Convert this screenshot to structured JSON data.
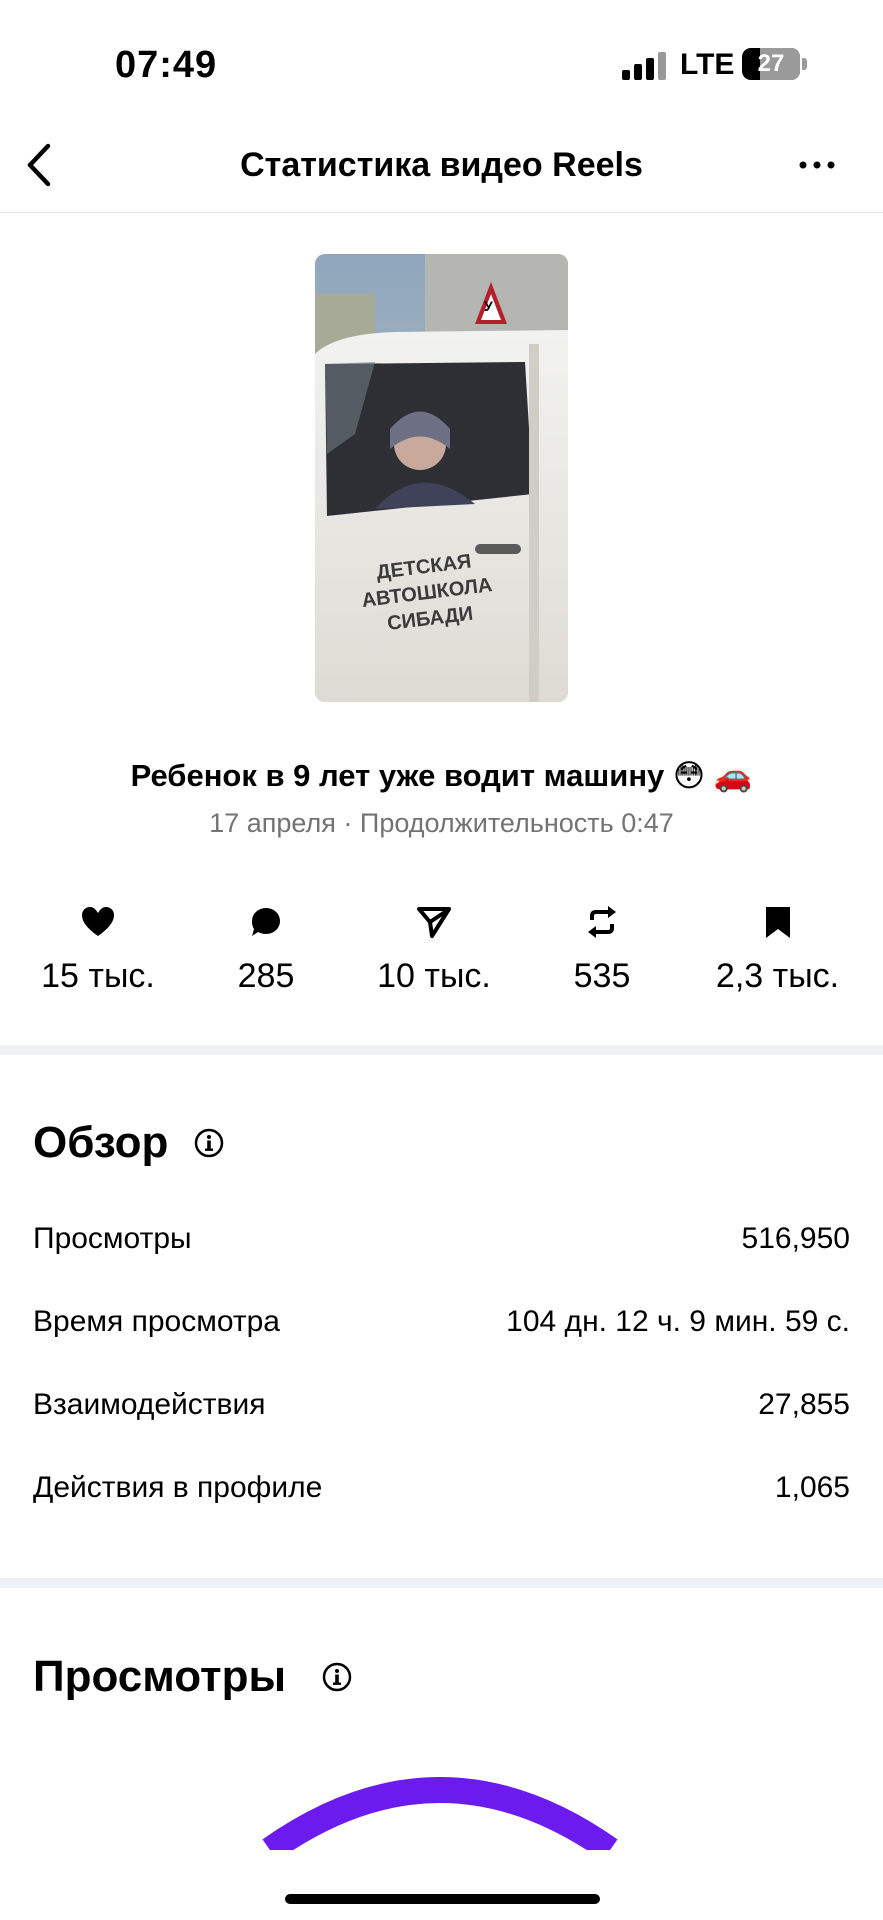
{
  "status_bar": {
    "time": "07:49",
    "network": "LTE",
    "battery": "27"
  },
  "header": {
    "title": "Статистика видео Reels",
    "back_icon": "chevron-left-icon",
    "more_icon": "more-horizontal-icon"
  },
  "thumbnail": {
    "caption_lines": [
      "ДЕТСКАЯ",
      "АВТОШКОЛА",
      "СИБАДИ"
    ],
    "sign_text": "У"
  },
  "reel": {
    "title": "Ребенок в 9 лет уже водит машину 😳 🚗",
    "meta": "17 апреля · Продолжительность 0:47"
  },
  "metrics": [
    {
      "icon": "heart-icon",
      "value": "15 тыс."
    },
    {
      "icon": "comment-icon",
      "value": "285"
    },
    {
      "icon": "send-icon",
      "value": "10 тыс."
    },
    {
      "icon": "repost-icon",
      "value": "535"
    },
    {
      "icon": "bookmark-icon",
      "value": "2,3 тыс."
    }
  ],
  "overview": {
    "title": "Обзор",
    "rows": [
      {
        "label": "Просмотры",
        "value": "516,950"
      },
      {
        "label": "Время просмотра",
        "value": "104 дн. 12 ч. 9 мин. 59 с."
      },
      {
        "label": "Взаимодействия",
        "value": "27,855"
      },
      {
        "label": "Действия в профиле",
        "value": "1,065"
      }
    ]
  },
  "views_section": {
    "title": "Просмотры"
  },
  "colors": {
    "accent": "#6C1BEF",
    "divider": "#F0F1F4",
    "meta_text": "#737373"
  }
}
